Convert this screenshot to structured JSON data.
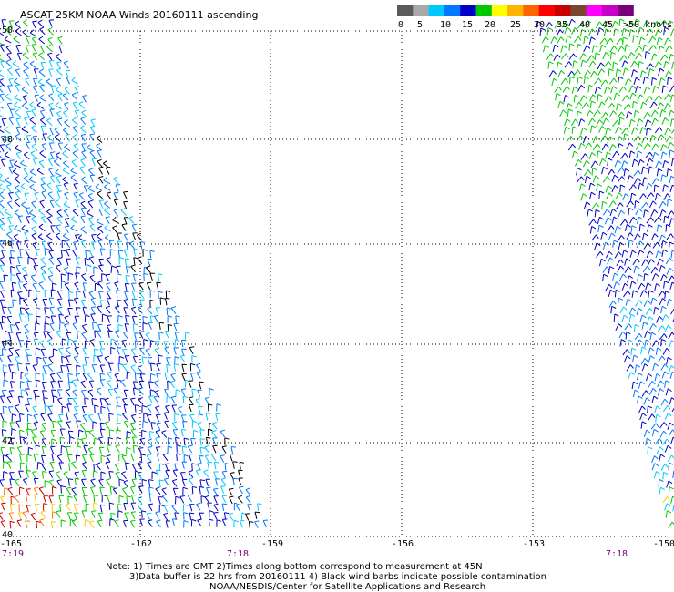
{
  "title": "ASCAT 25KM NOAA Winds 20160111 ascending",
  "legend": {
    "colors": [
      "#5a5a5a",
      "#a8a8a8",
      "#00c8ff",
      "#0078ff",
      "#0000c8",
      "#00c800",
      "#ffff00",
      "#ffb400",
      "#ff6400",
      "#ff0000",
      "#c80000",
      "#784632",
      "#ff00ff",
      "#c800c8",
      "#780078"
    ],
    "labels": [
      "0",
      "5",
      "10",
      "15",
      "20",
      "25",
      "30",
      "35",
      "40",
      "45",
      ">50 knots"
    ]
  },
  "lat_labels": [
    "50",
    "48",
    "46",
    "44",
    "42",
    "40"
  ],
  "lon_labels": [
    "-165",
    "-162",
    "-159",
    "-156",
    "-153",
    "-150"
  ],
  "time_labels": [
    "7:19",
    "7:18",
    "7:18"
  ],
  "notes": [
    "Note: 1) Times are GMT 2)Times along bottom correspond to measurement at 45N",
    "3)Data buffer is 22 hrs from 20160111 4) Black wind barbs indicate possible contamination",
    "NOAA/NESDIS/Center for Satellite Applications and Research"
  ],
  "colors": {
    "grid": "#000000",
    "lat_label": "#000000",
    "time_label": "#800080",
    "barb_blue": "#0000c8",
    "barb_lightblue": "#0078ff",
    "barb_cyan": "#00c8ff",
    "barb_green": "#00c800",
    "barb_yellow": "#ffc800",
    "barb_orange": "#ff7800",
    "barb_red": "#c80000",
    "barb_black": "#000000"
  },
  "map": {
    "lat_range": [
      40,
      50
    ],
    "lon_range": [
      -165,
      -150
    ],
    "swaths": [
      {
        "name": "west-swath",
        "time": "7:19",
        "notes": "mostly blue/cyan barbs, green and orange near south-west"
      },
      {
        "name": "east-swath",
        "time": "7:18",
        "notes": "green north, blue/cyan south"
      }
    ]
  }
}
